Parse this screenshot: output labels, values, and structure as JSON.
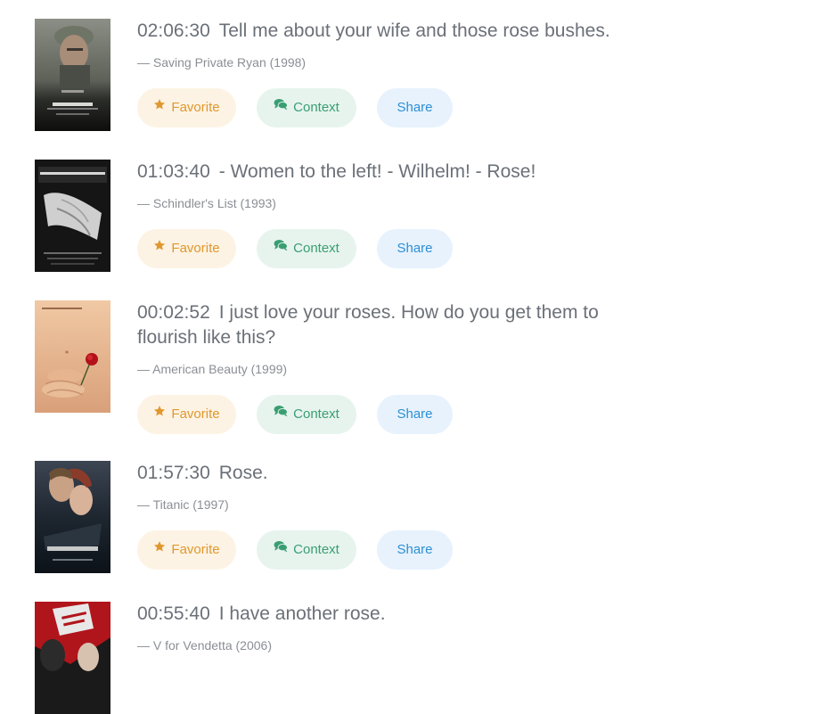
{
  "colors": {
    "favorite": "#e0982e",
    "context": "#3a9e73",
    "share": "#2d8fd3",
    "quote_text": "#6b7078",
    "source_text": "#8a8f95"
  },
  "results": [
    {
      "timestamp": "02:06:30",
      "quote": "Tell me about your wife and those rose bushes.",
      "source": "— Saving Private Ryan (1998)",
      "poster": "saving-private-ryan-poster",
      "favorite_label": "Favorite",
      "context_label": "Context",
      "share_label": "Share"
    },
    {
      "timestamp": "01:03:40",
      "quote": "- Women to the left! - Wilhelm! - Rose!",
      "source": "— Schindler's List (1993)",
      "poster": "schindlers-list-poster",
      "favorite_label": "Favorite",
      "context_label": "Context",
      "share_label": "Share"
    },
    {
      "timestamp": "00:02:52",
      "quote": "I just love your roses. How do you get them to flourish like this?",
      "source": "— American Beauty (1999)",
      "poster": "american-beauty-poster",
      "favorite_label": "Favorite",
      "context_label": "Context",
      "share_label": "Share"
    },
    {
      "timestamp": "01:57:30",
      "quote": "Rose.",
      "source": "— Titanic (1997)",
      "poster": "titanic-poster",
      "favorite_label": "Favorite",
      "context_label": "Context",
      "share_label": "Share"
    },
    {
      "timestamp": "00:55:40",
      "quote": "I have another rose.",
      "source": "— V for Vendetta (2006)",
      "poster": "v-for-vendetta-poster"
    }
  ],
  "icons": {
    "favorite": "star-icon",
    "context": "comments-icon"
  }
}
